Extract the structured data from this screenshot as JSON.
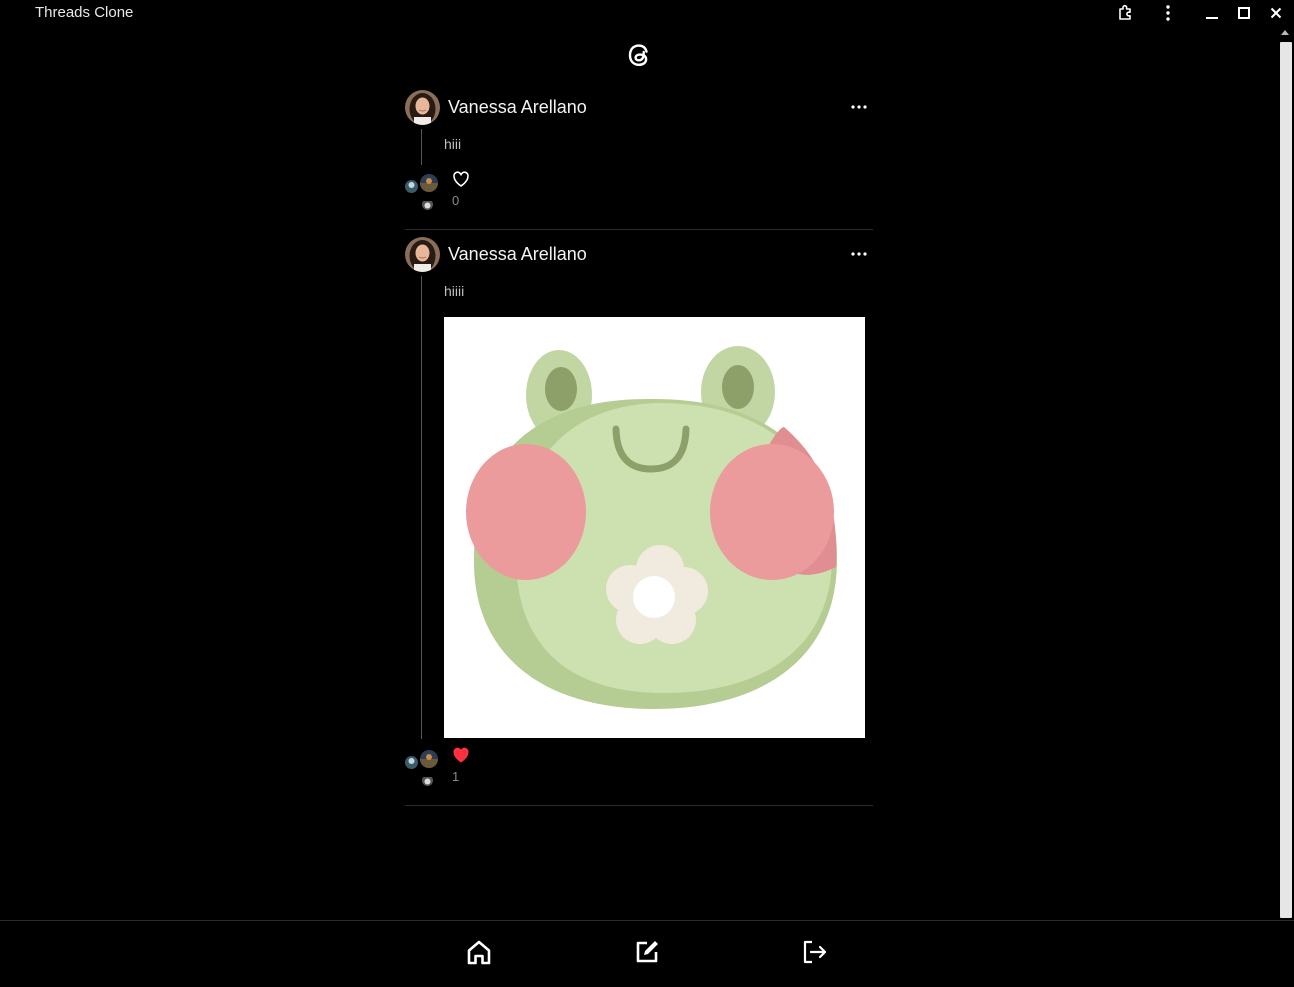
{
  "window": {
    "title": "Threads Clone",
    "controls": [
      "extensions-icon",
      "kebab-menu-icon",
      "minimize-icon",
      "maximize-icon",
      "close-icon"
    ]
  },
  "header": {
    "logo_icon": "threads-logo-icon"
  },
  "posts": [
    {
      "author": "Vanessa Arellano",
      "text": "hiii",
      "has_image": false,
      "liked": false,
      "likes": "0"
    },
    {
      "author": "Vanessa Arellano",
      "text": "hiiii",
      "has_image": true,
      "image_subject": "frog-illustration",
      "liked": true,
      "likes": "1"
    }
  ],
  "bottom_nav": {
    "items": [
      {
        "icon": "home-icon"
      },
      {
        "icon": "compose-icon"
      },
      {
        "icon": "logout-icon"
      }
    ]
  },
  "colors": {
    "background": "#000000",
    "like_active": "#ff3040",
    "divider": "#2c2c2c"
  }
}
